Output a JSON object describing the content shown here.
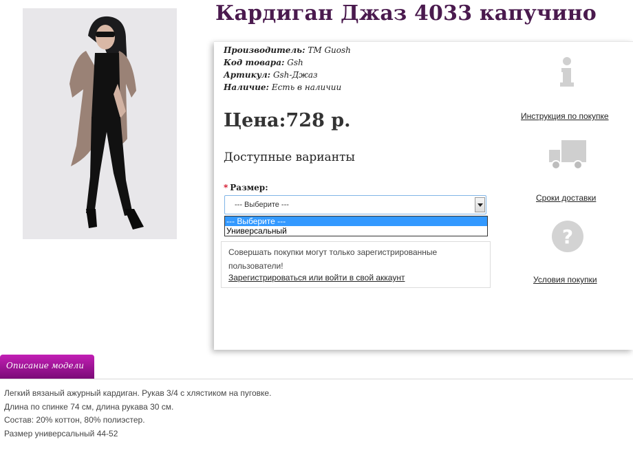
{
  "product": {
    "title": "Кардиган Джаз 4033 капучино",
    "manufacturer_label": "Производитель:",
    "manufacturer_value": "TM Guosh",
    "code_label": "Код товара:",
    "code_value": "Gsh",
    "article_label": "Артикул:",
    "article_value": "Gsh-Джаз",
    "availability_label": "Наличие:",
    "availability_value": "Есть в наличии",
    "price": "Цена:728 р.",
    "variants_heading": "Доступные варианты",
    "size_label": "Размер:",
    "size_required_mark": "*",
    "size_select_value": "--- Выберите ---",
    "size_options": [
      "--- Выберите ---",
      "Универсальный"
    ]
  },
  "notice": {
    "text": "Совершать покупки могут только зарегистрированные пользователи!",
    "link": "Зарегистрироваться или войти в свой аккаунт"
  },
  "side_links": {
    "instructions": "Инструкция по покупке",
    "delivery": "Сроки доставки",
    "terms": "Условия покупки"
  },
  "icons": {
    "info": "info-icon",
    "truck": "truck-icon",
    "question": "question-icon"
  },
  "tabs": {
    "description": "Описание модели"
  },
  "description": {
    "line1": "Легкий вязаный ажурный кардиган. Рукав 3/4 с хлястиком на пуговке.",
    "line2": "Длина по спинке 74 см, длина рукава 30 см.",
    "line3": "Состав: 20% коттон, 80% полиэстер.",
    "line4": "Размер универсальный 44-52"
  },
  "colors": {
    "title": "#4a1a4e",
    "tab": "#a0159a",
    "select_highlight": "#3399ff"
  }
}
